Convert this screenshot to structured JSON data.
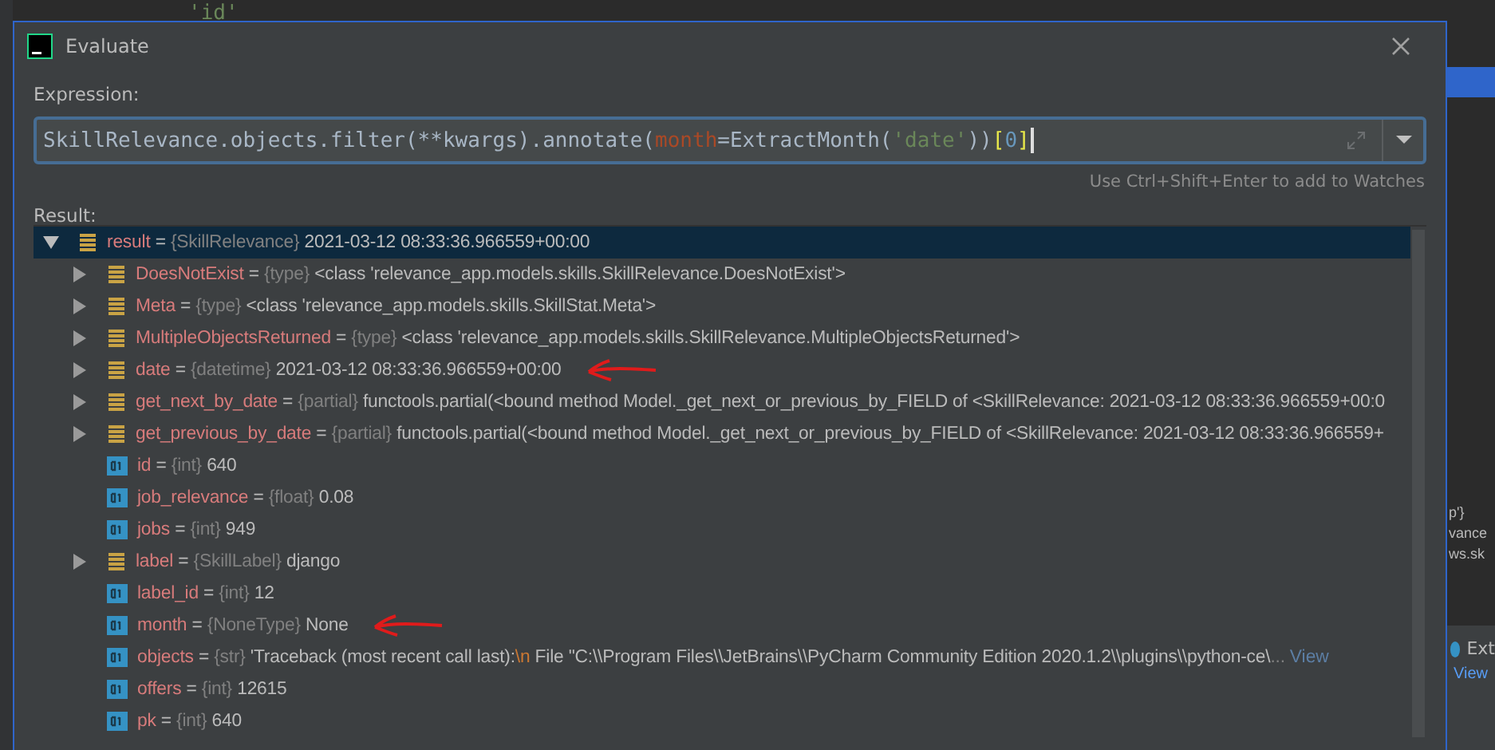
{
  "background_editor": {
    "code_line": "'id'",
    "right_fragments": [
      {
        "text": "p'}"
      },
      {
        "text": "vance"
      },
      {
        "text": "ws.sk"
      }
    ],
    "notification": {
      "title": "Ext",
      "link": "View"
    }
  },
  "window": {
    "title": "Evaluate"
  },
  "expression": {
    "label": "Expression:",
    "segments": [
      {
        "text": "SkillRelevance.objects.filter(**kwargs).annotate(",
        "kind": "plain"
      },
      {
        "text": "month",
        "kind": "param"
      },
      {
        "text": "=ExtractMonth(",
        "kind": "plain"
      },
      {
        "text": "'date'",
        "kind": "string"
      },
      {
        "text": "))",
        "kind": "plain"
      },
      {
        "text": "[",
        "kind": "bracket"
      },
      {
        "text": "0",
        "kind": "number"
      },
      {
        "text": "]",
        "kind": "bracket"
      }
    ],
    "hint": "Use Ctrl+Shift+Enter to add to Watches"
  },
  "result": {
    "label": "Result:",
    "root": {
      "name": "result",
      "operator": "=",
      "type": "{SkillRelevance}",
      "value": "2021-03-12 08:33:36.966559+00:00",
      "expanded": true,
      "selected": true,
      "children": [
        {
          "kind": "object",
          "name": "DoesNotExist",
          "type": "{type}",
          "value": "<class 'relevance_app.models.skills.SkillRelevance.DoesNotExist'>",
          "annotated": false
        },
        {
          "kind": "object",
          "name": "Meta",
          "type": "{type}",
          "value": "<class 'relevance_app.models.skills.SkillStat.Meta'>",
          "annotated": false
        },
        {
          "kind": "object",
          "name": "MultipleObjectsReturned",
          "type": "{type}",
          "value": "<class 'relevance_app.models.skills.SkillRelevance.MultipleObjectsReturned'>",
          "annotated": false
        },
        {
          "kind": "object",
          "name": "date",
          "type": "{datetime}",
          "value": "2021-03-12 08:33:36.966559+00:00",
          "annotated": true
        },
        {
          "kind": "object",
          "name": "get_next_by_date",
          "type": "{partial}",
          "value": "functools.partial(<bound method Model._get_next_or_previous_by_FIELD of <SkillRelevance: 2021-03-12 08:33:36.966559+00:0",
          "annotated": false
        },
        {
          "kind": "object",
          "name": "get_previous_by_date",
          "type": "{partial}",
          "value": "functools.partial(<bound method Model._get_next_or_previous_by_FIELD of <SkillRelevance: 2021-03-12 08:33:36.966559+",
          "annotated": false
        },
        {
          "kind": "primitive",
          "name": "id",
          "type": "{int}",
          "value": "640",
          "annotated": false
        },
        {
          "kind": "primitive",
          "name": "job_relevance",
          "type": "{float}",
          "value": "0.08",
          "annotated": false
        },
        {
          "kind": "primitive",
          "name": "jobs",
          "type": "{int}",
          "value": "949",
          "annotated": false
        },
        {
          "kind": "object",
          "name": "label",
          "type": "{SkillLabel}",
          "value": "django",
          "annotated": false
        },
        {
          "kind": "primitive",
          "name": "label_id",
          "type": "{int}",
          "value": "12",
          "annotated": false
        },
        {
          "kind": "primitive",
          "name": "month",
          "type": "{NoneType}",
          "value": "None",
          "annotated": true
        },
        {
          "kind": "primitive",
          "name": "objects",
          "type": "{str}",
          "value": "'Traceback (most recent call last):",
          "escape": "\\n",
          "value_tail": "  File \"C:\\\\Program Files\\\\JetBrains\\\\PyCharm Community Edition 2020.1.2\\\\plugins\\\\python-ce\\",
          "ellipsis": "...",
          "link": "View",
          "annotated": false
        },
        {
          "kind": "primitive",
          "name": "offers",
          "type": "{int}",
          "value": "12615",
          "annotated": false
        },
        {
          "kind": "primitive",
          "name": "pk",
          "type": "{int}",
          "value": "640",
          "annotated": false
        }
      ]
    }
  }
}
